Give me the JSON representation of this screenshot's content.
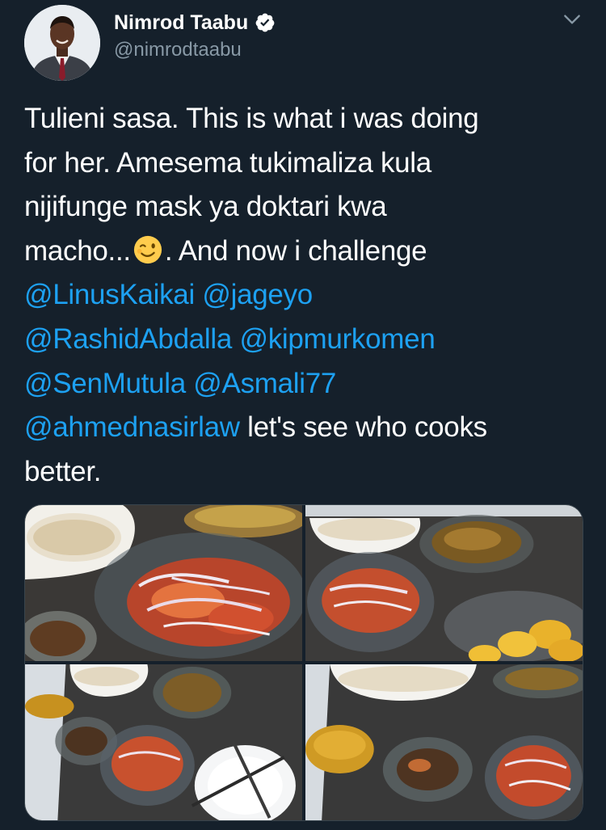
{
  "author": {
    "display_name": "Nimrod Taabu",
    "handle": "@nimrodtaabu",
    "verified": true,
    "avatar_icon": "profile-photo",
    "verified_icon": "verified-badge-icon"
  },
  "tweet": {
    "lines": [
      [
        {
          "text": "Tulieni sasa. This is what i was doing",
          "type": "text"
        }
      ],
      [
        {
          "text": "for her. Amesema tukimaliza kula",
          "type": "text"
        }
      ],
      [
        {
          "text": "nijifunge mask ya doktari kwa",
          "type": "text"
        }
      ],
      [
        {
          "text": "macho...",
          "type": "text"
        },
        {
          "emoji": "winking-face",
          "type": "emoji"
        },
        {
          "text": ". And now i challenge",
          "type": "text"
        }
      ],
      [
        {
          "text": "@LinusKaikai",
          "type": "mention"
        },
        {
          "text": " ",
          "type": "text"
        },
        {
          "text": "@jageyo",
          "type": "mention"
        }
      ],
      [
        {
          "text": "@RashidAbdalla",
          "type": "mention"
        },
        {
          "text": " ",
          "type": "text"
        },
        {
          "text": "@kipmurkomen",
          "type": "mention"
        }
      ],
      [
        {
          "text": "@SenMutula",
          "type": "mention"
        },
        {
          "text": " ",
          "type": "text"
        },
        {
          "text": "@Asmali77",
          "type": "mention"
        }
      ],
      [
        {
          "text": "@ahmednasirlaw",
          "type": "mention"
        },
        {
          "text": " let's see who cooks",
          "type": "text"
        }
      ],
      [
        {
          "text": "better.",
          "type": "text"
        }
      ]
    ]
  },
  "media": {
    "photos": [
      {
        "name": "photo-1",
        "description": "onion tomato salad bowl with rice dish"
      },
      {
        "name": "photo-2",
        "description": "salad bowl, fried fish and potatoes"
      },
      {
        "name": "photo-3",
        "description": "table spread with salad, sauce and plate"
      },
      {
        "name": "photo-4",
        "description": "rice, sauce boat, beef and salad bowls"
      }
    ]
  },
  "colors": {
    "background": "#15202b",
    "text": "#ffffff",
    "secondary_text": "#8899a6",
    "link": "#1da1f2",
    "verified": "#ffffff"
  },
  "icons": {
    "more_menu": "chevron-down-icon"
  }
}
